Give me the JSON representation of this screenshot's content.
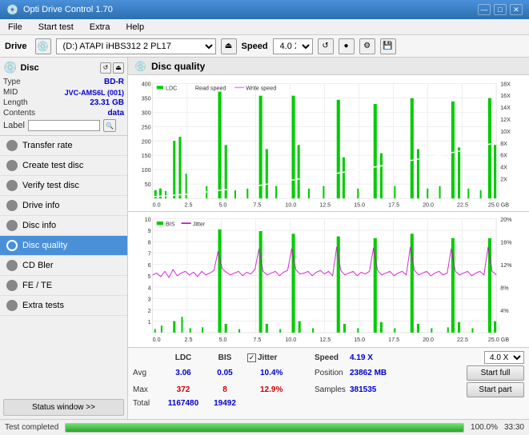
{
  "app": {
    "title": "Opti Drive Control 1.70",
    "icon": "💿"
  },
  "title_bar": {
    "title": "Opti Drive Control 1.70",
    "minimize": "—",
    "maximize": "□",
    "close": "✕"
  },
  "menu": {
    "items": [
      "File",
      "Start test",
      "Extra",
      "Help"
    ]
  },
  "drive_bar": {
    "label": "Drive",
    "drive_value": "(D:) ATAPI iHBS312  2 PL17",
    "speed_label": "Speed",
    "speed_value": "4.0 X"
  },
  "disc_section": {
    "title": "Disc",
    "rows": [
      {
        "key": "Type",
        "val": "BD-R",
        "blue": true
      },
      {
        "key": "MID",
        "val": "JVC-AMS6L (001)",
        "blue": true
      },
      {
        "key": "Length",
        "val": "23.31 GB",
        "blue": true
      },
      {
        "key": "Contents",
        "val": "data",
        "blue": true
      }
    ],
    "label_key": "Label",
    "label_placeholder": ""
  },
  "nav_items": [
    {
      "id": "transfer-rate",
      "label": "Transfer rate",
      "active": false
    },
    {
      "id": "create-test-disc",
      "label": "Create test disc",
      "active": false
    },
    {
      "id": "verify-test-disc",
      "label": "Verify test disc",
      "active": false
    },
    {
      "id": "drive-info",
      "label": "Drive info",
      "active": false
    },
    {
      "id": "disc-info",
      "label": "Disc info",
      "active": false
    },
    {
      "id": "disc-quality",
      "label": "Disc quality",
      "active": true
    },
    {
      "id": "cd-bler",
      "label": "CD Bler",
      "active": false
    },
    {
      "id": "fe-te",
      "label": "FE / TE",
      "active": false
    },
    {
      "id": "extra-tests",
      "label": "Extra tests",
      "active": false
    }
  ],
  "status_window_btn": "Status window >>",
  "disc_quality": {
    "title": "Disc quality",
    "legend": {
      "ldc": "LDC",
      "read_speed": "Read speed",
      "write_speed": "Write speed",
      "bis": "BIS",
      "jitter": "Jitter"
    }
  },
  "chart1": {
    "y_max": 400,
    "y_labels_left": [
      "400",
      "350",
      "300",
      "250",
      "200",
      "150",
      "100",
      "50"
    ],
    "y_labels_right": [
      "18X",
      "16X",
      "14X",
      "12X",
      "10X",
      "8X",
      "6X",
      "4X",
      "2X"
    ],
    "x_labels": [
      "0.0",
      "2.5",
      "5.0",
      "7.5",
      "10.0",
      "12.5",
      "15.0",
      "17.5",
      "20.0",
      "22.5",
      "25.0 GB"
    ]
  },
  "chart2": {
    "y_max": 10,
    "y_labels_left": [
      "10",
      "9",
      "8",
      "7",
      "6",
      "5",
      "4",
      "3",
      "2",
      "1"
    ],
    "y_labels_right": [
      "20%",
      "16%",
      "12%",
      "8%",
      "4%"
    ],
    "x_labels": [
      "0.0",
      "2.5",
      "5.0",
      "7.5",
      "10.0",
      "12.5",
      "15.0",
      "17.5",
      "20.0",
      "22.5",
      "25.0 GB"
    ]
  },
  "stats": {
    "headers": [
      "",
      "LDC",
      "BIS",
      "",
      "Jitter",
      "Speed",
      "",
      ""
    ],
    "avg_label": "Avg",
    "max_label": "Max",
    "total_label": "Total",
    "ldc_avg": "3.06",
    "ldc_max": "372",
    "ldc_total": "1167480",
    "bis_avg": "0.05",
    "bis_max": "8",
    "bis_total": "19492",
    "jitter_avg": "10.4%",
    "jitter_max": "12.9%",
    "jitter_checked": true,
    "speed_label": "Speed",
    "speed_val": "4.19 X",
    "speed_select": "4.0 X",
    "position_label": "Position",
    "position_val": "23862 MB",
    "samples_label": "Samples",
    "samples_val": "381535",
    "start_full_btn": "Start full",
    "start_part_btn": "Start part"
  },
  "status_bar": {
    "status_text": "Test completed",
    "progress_percent": 100,
    "time": "33:30"
  }
}
